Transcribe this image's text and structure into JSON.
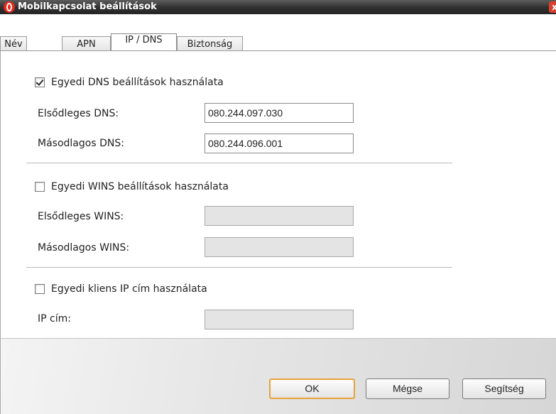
{
  "window": {
    "title": "Mobilkapcsolat beállítások",
    "close_glyph": "x"
  },
  "tabs": [
    {
      "label": "Név"
    },
    {
      "label": "APN"
    },
    {
      "label": "IP / DNS",
      "active": true
    },
    {
      "label": "Biztonság"
    }
  ],
  "dns": {
    "checkbox_label": "Egyedi DNS beállítások használata",
    "checked": true,
    "primary_label": "Elsődleges DNS:",
    "primary_value": "080.244.097.030",
    "secondary_label": "Másodlagos DNS:",
    "secondary_value": "080.244.096.001"
  },
  "wins": {
    "checkbox_label": "Egyedi WINS beállítások használata",
    "checked": false,
    "primary_label": "Elsődleges WINS:",
    "primary_value": "",
    "secondary_label": "Másodlagos WINS:",
    "secondary_value": ""
  },
  "client_ip": {
    "checkbox_label": "Egyedi kliens IP cím használata",
    "checked": false,
    "ip_label": "IP cím:",
    "ip_value": ""
  },
  "buttons": {
    "ok": "OK",
    "cancel": "Mégse",
    "help": "Segítség"
  },
  "colors": {
    "default_button_border": "#e8a23a",
    "logo": "#e52a1a"
  }
}
